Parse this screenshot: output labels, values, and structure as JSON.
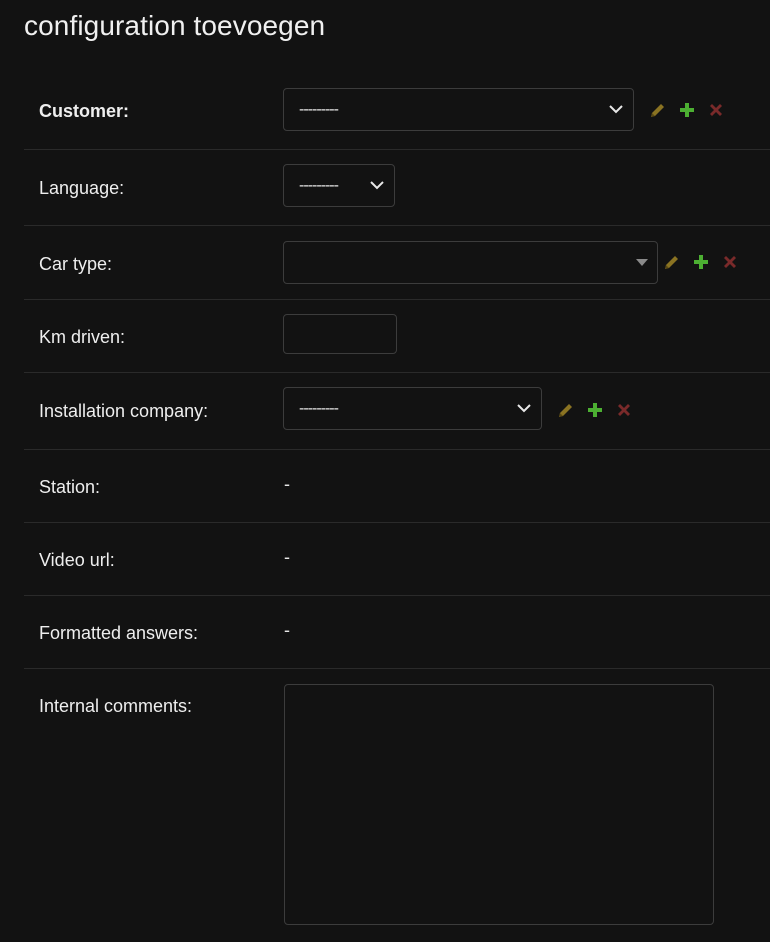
{
  "page": {
    "title": "configuration toevoegen"
  },
  "fields": {
    "customer": {
      "label": "Customer:",
      "value": "---------"
    },
    "language": {
      "label": "Language:",
      "value": "---------"
    },
    "car_type": {
      "label": "Car type:",
      "value": ""
    },
    "km_driven": {
      "label": "Km driven:",
      "value": ""
    },
    "installation_company": {
      "label": "Installation company:",
      "value": "---------"
    },
    "station": {
      "label": "Station:",
      "value": "-"
    },
    "video_url": {
      "label": "Video url:",
      "value": "-"
    },
    "formatted_answers": {
      "label": "Formatted answers:",
      "value": "-"
    },
    "internal_comments": {
      "label": "Internal comments:",
      "value": ""
    }
  },
  "icons": {
    "edit": "pencil-icon",
    "add": "plus-icon",
    "delete": "x-icon"
  },
  "colors": {
    "background": "#121212",
    "edit_icon": "#8a7322",
    "add_icon": "#4caf32",
    "delete_icon": "#7a2a2a"
  }
}
